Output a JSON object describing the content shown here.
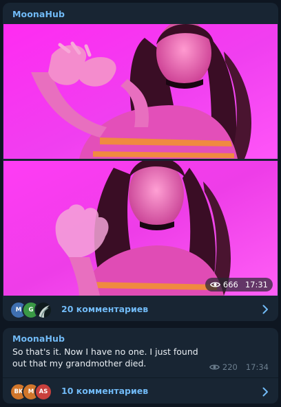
{
  "post1": {
    "channel": "MoonaHub",
    "views": "666",
    "time": "17:31",
    "comments_label": "20 комментариев",
    "avatars": [
      {
        "initials": "M",
        "color": "#3f6fb0"
      },
      {
        "initials": "G",
        "color": "#3a9a45"
      },
      {
        "initials": "",
        "color": "#1b2a2e"
      }
    ]
  },
  "post2": {
    "channel": "MoonaHub",
    "text": "So that's it. Now I have no one. I just found out that my grandmother died.",
    "views": "220",
    "time": "17:34",
    "comments_label": "10 комментариев",
    "avatars": [
      {
        "initials": "BK",
        "color": "#d1762b"
      },
      {
        "initials": "M",
        "color": "#d1762b"
      },
      {
        "initials": "AS",
        "color": "#c9403d"
      }
    ]
  },
  "icons": {
    "eye": "eye-icon",
    "chevron": "chevron-right-icon"
  }
}
